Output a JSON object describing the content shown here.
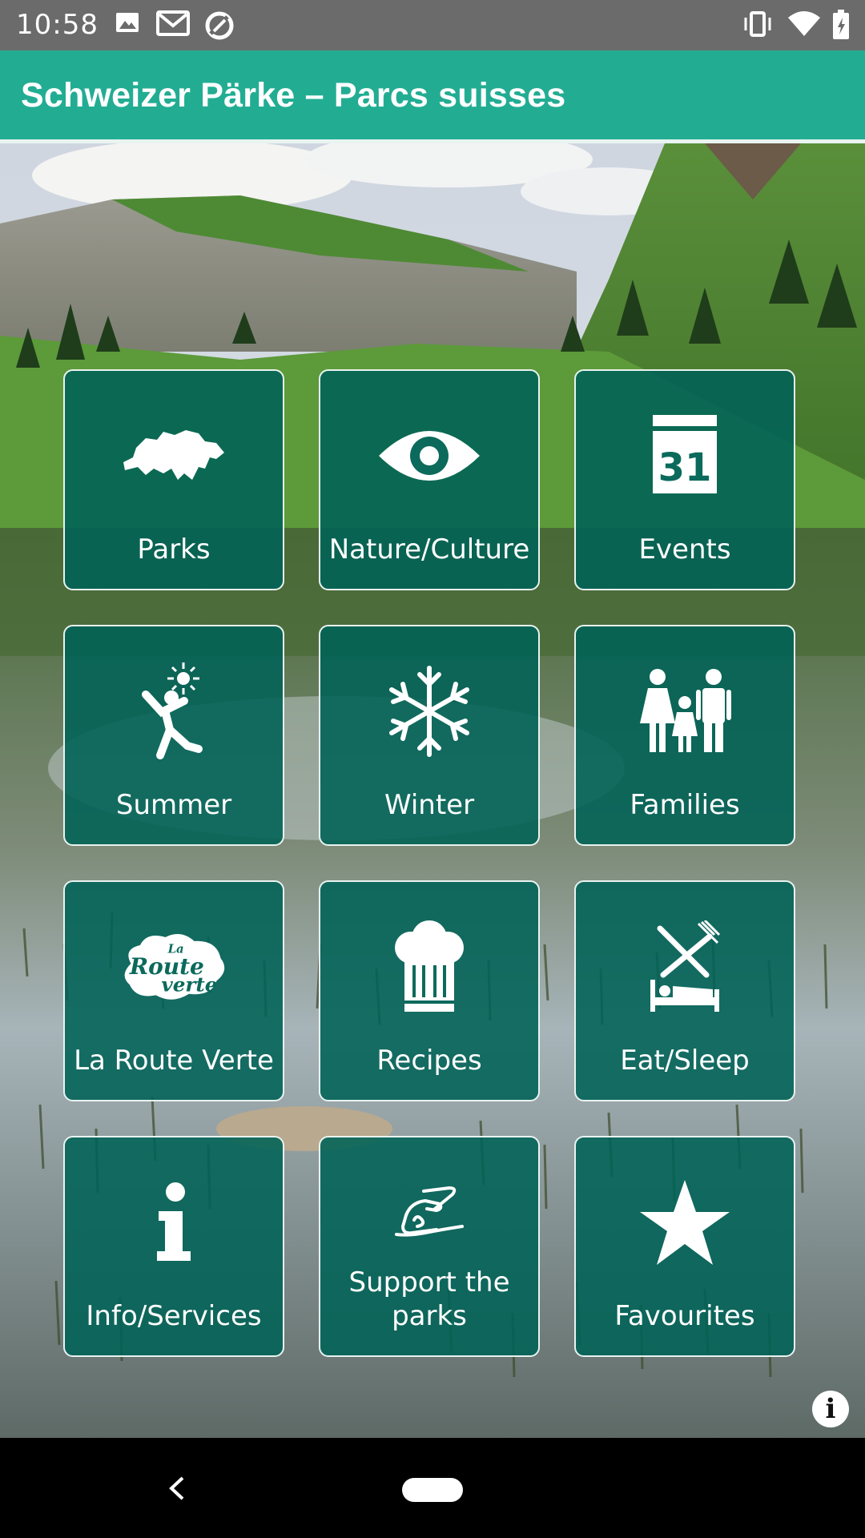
{
  "status_bar": {
    "time": "10:58",
    "left_icons": [
      "image-icon",
      "gmail-icon",
      "data-saver-icon"
    ],
    "right_icons": [
      "vibrate-icon",
      "wifi-icon",
      "battery-icon"
    ]
  },
  "app_bar": {
    "title": "Schweizer Pärke – Parcs suisses",
    "color": "#22ad93"
  },
  "tiles": [
    {
      "label": "Parks",
      "icon": "switzerland-map-icon"
    },
    {
      "label": "Nature/Culture",
      "icon": "eye-icon"
    },
    {
      "label": "Events",
      "icon": "calendar-icon",
      "icon_text": "31"
    },
    {
      "label": "Summer",
      "icon": "summer-person-icon"
    },
    {
      "label": "Winter",
      "icon": "snowflake-icon"
    },
    {
      "label": "Families",
      "icon": "family-icon"
    },
    {
      "label": "La Route Verte",
      "icon": "la-route-verte-logo",
      "logo_text": [
        "La",
        "Route",
        "verte"
      ]
    },
    {
      "label": "Recipes",
      "icon": "chef-hat-icon"
    },
    {
      "label": "Eat/Sleep",
      "icon": "eat-sleep-icon"
    },
    {
      "label": "Info/Services",
      "icon": "info-icon"
    },
    {
      "label": "Support the parks",
      "label_lines": [
        "Support the",
        "parks"
      ],
      "icon": "signature-hand-icon"
    },
    {
      "label": "Favourites",
      "icon": "star-icon"
    }
  ],
  "tile_color": "#006256",
  "nav_bar": {
    "back": "back-icon",
    "home": "home-pill"
  }
}
